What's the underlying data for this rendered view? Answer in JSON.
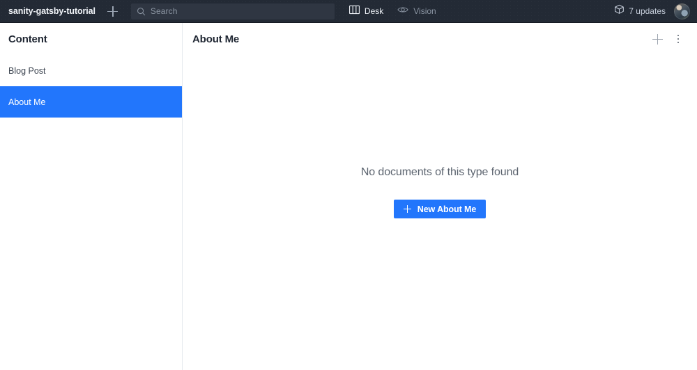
{
  "topbar": {
    "project_name": "sanity-gatsby-tutorial",
    "add_icon": "plus-icon",
    "search": {
      "placeholder": "Search",
      "value": "",
      "icon": "search-icon"
    },
    "nav": [
      {
        "label": "Desk",
        "icon": "columns-icon",
        "active": true
      },
      {
        "label": "Vision",
        "icon": "eye-icon",
        "active": false
      }
    ],
    "updates": {
      "label": "7 updates",
      "count": 7,
      "icon": "package-icon"
    },
    "avatar": "user-avatar",
    "colors": {
      "background": "#232a35",
      "search_background": "#2f3642",
      "text_muted": "#8b95a3",
      "text_active": "#eef2f7"
    }
  },
  "sidebar": {
    "title": "Content",
    "items": [
      {
        "label": "Blog Post",
        "selected": false
      },
      {
        "label": "About Me",
        "selected": true
      }
    ]
  },
  "main": {
    "title": "About Me",
    "actions": [
      {
        "name": "create-new",
        "icon": "plus-icon"
      },
      {
        "name": "pane-menu",
        "icon": "kebab-menu-icon"
      }
    ],
    "empty_state": {
      "message": "No documents of this type found",
      "button_label": "New About Me",
      "button_icon": "plus-icon"
    }
  },
  "colors": {
    "accent": "#2276fc",
    "panel_border": "#e4e8ed",
    "heading": "#1f2632",
    "body_text": "#3b434f",
    "muted_text": "#5c646f"
  }
}
